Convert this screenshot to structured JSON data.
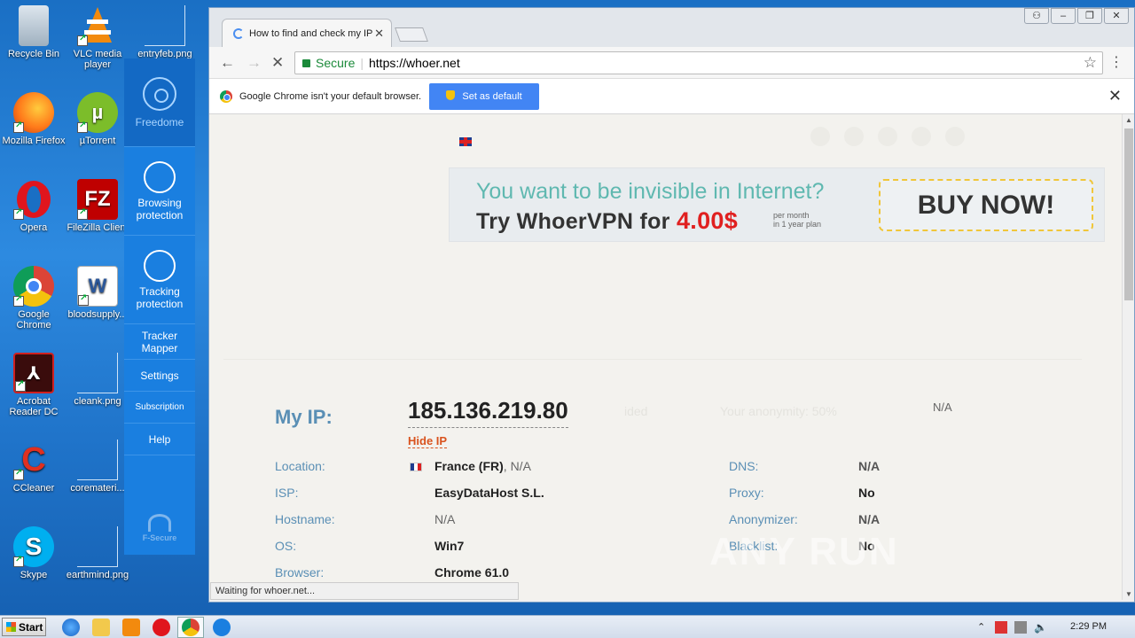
{
  "desktop": {
    "icons": [
      {
        "label": "Recycle Bin"
      },
      {
        "label": "VLC media player"
      },
      {
        "label": "entryfeb.png"
      },
      {
        "label": "Mozilla Firefox"
      },
      {
        "label": "µTorrent"
      },
      {
        "label": "Opera"
      },
      {
        "label": "FileZilla Client"
      },
      {
        "label": "Google Chrome"
      },
      {
        "label": "bloodsupply..."
      },
      {
        "label": "Acrobat Reader DC"
      },
      {
        "label": "cleank.png"
      },
      {
        "label": "CCleaner"
      },
      {
        "label": "coremateri..."
      },
      {
        "label": "Skype"
      },
      {
        "label": "earthmind.png"
      }
    ]
  },
  "fsecure": {
    "items": [
      {
        "label": "Freedome"
      },
      {
        "label": "Browsing protection"
      },
      {
        "label": "Tracking protection"
      },
      {
        "label": "Tracker Mapper"
      },
      {
        "label": "Settings"
      },
      {
        "label": "Subscription"
      },
      {
        "label": "Help"
      }
    ],
    "logo": "F-Secure"
  },
  "browser": {
    "tab_title": "How to find and check my IP",
    "omnibox": {
      "secure_label": "Secure",
      "url": "https://whoer.net"
    },
    "infobar": {
      "message": "Google Chrome isn't your default browser.",
      "button": "Set as default"
    },
    "status": "Waiting for whoer.net..."
  },
  "page": {
    "banner": {
      "line1": "You want to be invisible in Internet?",
      "line2_prefix": "Try WhoerVPN for ",
      "price": "4.00$",
      "per_month": "per month",
      "per_plan": "in 1 year plan",
      "buy": "BUY NOW!"
    },
    "myip_label": "My IP:",
    "ip": "185.136.219.80",
    "hide_ip": "Hide IP",
    "faint_1": "ided",
    "faint_2": "Your anonymity: 50%",
    "na_top": "N/A",
    "left_rows": [
      {
        "label": "Location:",
        "value": "France (FR)",
        "extra": ", N/A"
      },
      {
        "label": "ISP:",
        "value": "EasyDataHost S.L."
      },
      {
        "label": "Hostname:",
        "value": "N/A"
      },
      {
        "label": "OS:",
        "value": "Win7"
      },
      {
        "label": "Browser:",
        "value": "Chrome 61.0"
      }
    ],
    "right_rows": [
      {
        "label": "DNS:",
        "value": "N/A"
      },
      {
        "label": "Proxy:",
        "value": "No"
      },
      {
        "label": "Anonymizer:",
        "value": "N/A"
      },
      {
        "label": "Blacklist:",
        "value": "No"
      }
    ]
  },
  "watermark": "ANY RUN",
  "taskbar": {
    "start": "Start",
    "clock": "2:29 PM"
  }
}
